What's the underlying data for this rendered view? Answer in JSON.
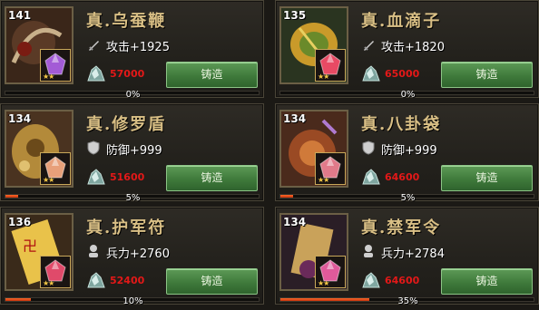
{
  "forge_label": "铸造",
  "stars": "★★",
  "items": [
    {
      "level": "141",
      "title": "真.乌蚕鞭",
      "stat_icon": "sword-icon",
      "stat": "攻击+1925",
      "cost": "57000",
      "progress_text": "0%",
      "progress": 0
    },
    {
      "level": "135",
      "title": "真.血滴子",
      "stat_icon": "sword-icon",
      "stat": "攻击+1820",
      "cost": "65000",
      "progress_text": "0%",
      "progress": 0
    },
    {
      "level": "134",
      "title": "真.修罗盾",
      "stat_icon": "shield-icon",
      "stat": "防御+999",
      "cost": "51600",
      "progress_text": "5%",
      "progress": 0.05
    },
    {
      "level": "134",
      "title": "真.八卦袋",
      "stat_icon": "shield-icon",
      "stat": "防御+999",
      "cost": "64600",
      "progress_text": "5%",
      "progress": 0.05
    },
    {
      "level": "136",
      "title": "真.护军符",
      "stat_icon": "soldier-icon",
      "stat": "兵力+2760",
      "cost": "52400",
      "progress_text": "10%",
      "progress": 0.1
    },
    {
      "level": "134",
      "title": "真.禁军令",
      "stat_icon": "soldier-icon",
      "stat": "兵力+2784",
      "cost": "64600",
      "progress_text": "35%",
      "progress": 0.35
    }
  ],
  "colors": {
    "cost": "#e31818",
    "title": "#d9bf85",
    "button": "#3f7a3b",
    "progress": "#e04a18"
  }
}
